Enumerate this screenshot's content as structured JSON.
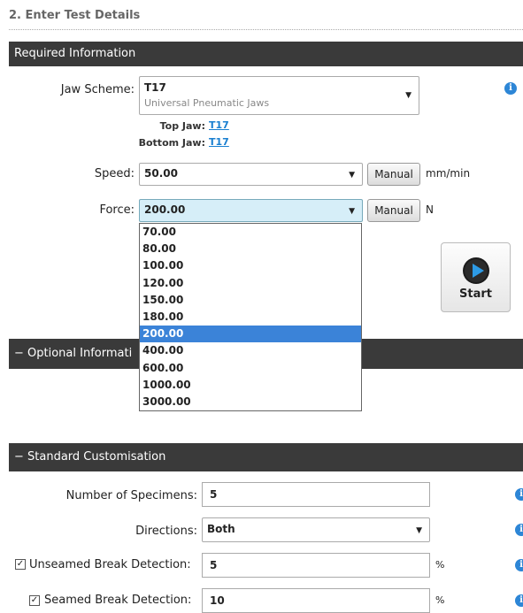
{
  "step_title": "2. Enter Test Details",
  "required": {
    "header": "Required Information",
    "jaw_scheme": {
      "label": "Jaw Scheme:",
      "value": "T17",
      "sub": "Universal Pneumatic Jaws",
      "top_jaw_label": "Top Jaw:",
      "top_jaw_value": "T17",
      "bottom_jaw_label": "Bottom Jaw:",
      "bottom_jaw_value": "T17"
    },
    "speed": {
      "label": "Speed:",
      "value": "50.00",
      "button": "Manual",
      "unit": "mm/min"
    },
    "force": {
      "label": "Force:",
      "value": "200.00",
      "button": "Manual",
      "unit": "N",
      "options": [
        "70.00",
        "80.00",
        "100.00",
        "120.00",
        "150.00",
        "180.00",
        "200.00",
        "400.00",
        "600.00",
        "1000.00",
        "3000.00"
      ],
      "selected_index": 6
    },
    "start_label": "Start"
  },
  "optional": {
    "header": "− Optional Informati"
  },
  "standard": {
    "header": "− Standard Customisation",
    "specimens": {
      "label": "Number of Specimens:",
      "value": "5"
    },
    "directions": {
      "label": "Directions:",
      "value": "Both"
    },
    "unseamed": {
      "label": "Unseamed Break Detection:",
      "value": "5",
      "unit": "%",
      "checked": true
    },
    "seamed": {
      "label": "Seamed Break Detection:",
      "value": "10",
      "unit": "%",
      "checked": true
    }
  },
  "colors": {
    "header_bg": "#3a3a3a",
    "selected_option": "#3b83d8",
    "info_icon": "#2d86d6",
    "link": "#1a7fd0"
  },
  "icons": {
    "info": "info-icon",
    "start": "play-icon",
    "dropdown": "chevron-down-icon",
    "check": "checkmark-icon"
  }
}
